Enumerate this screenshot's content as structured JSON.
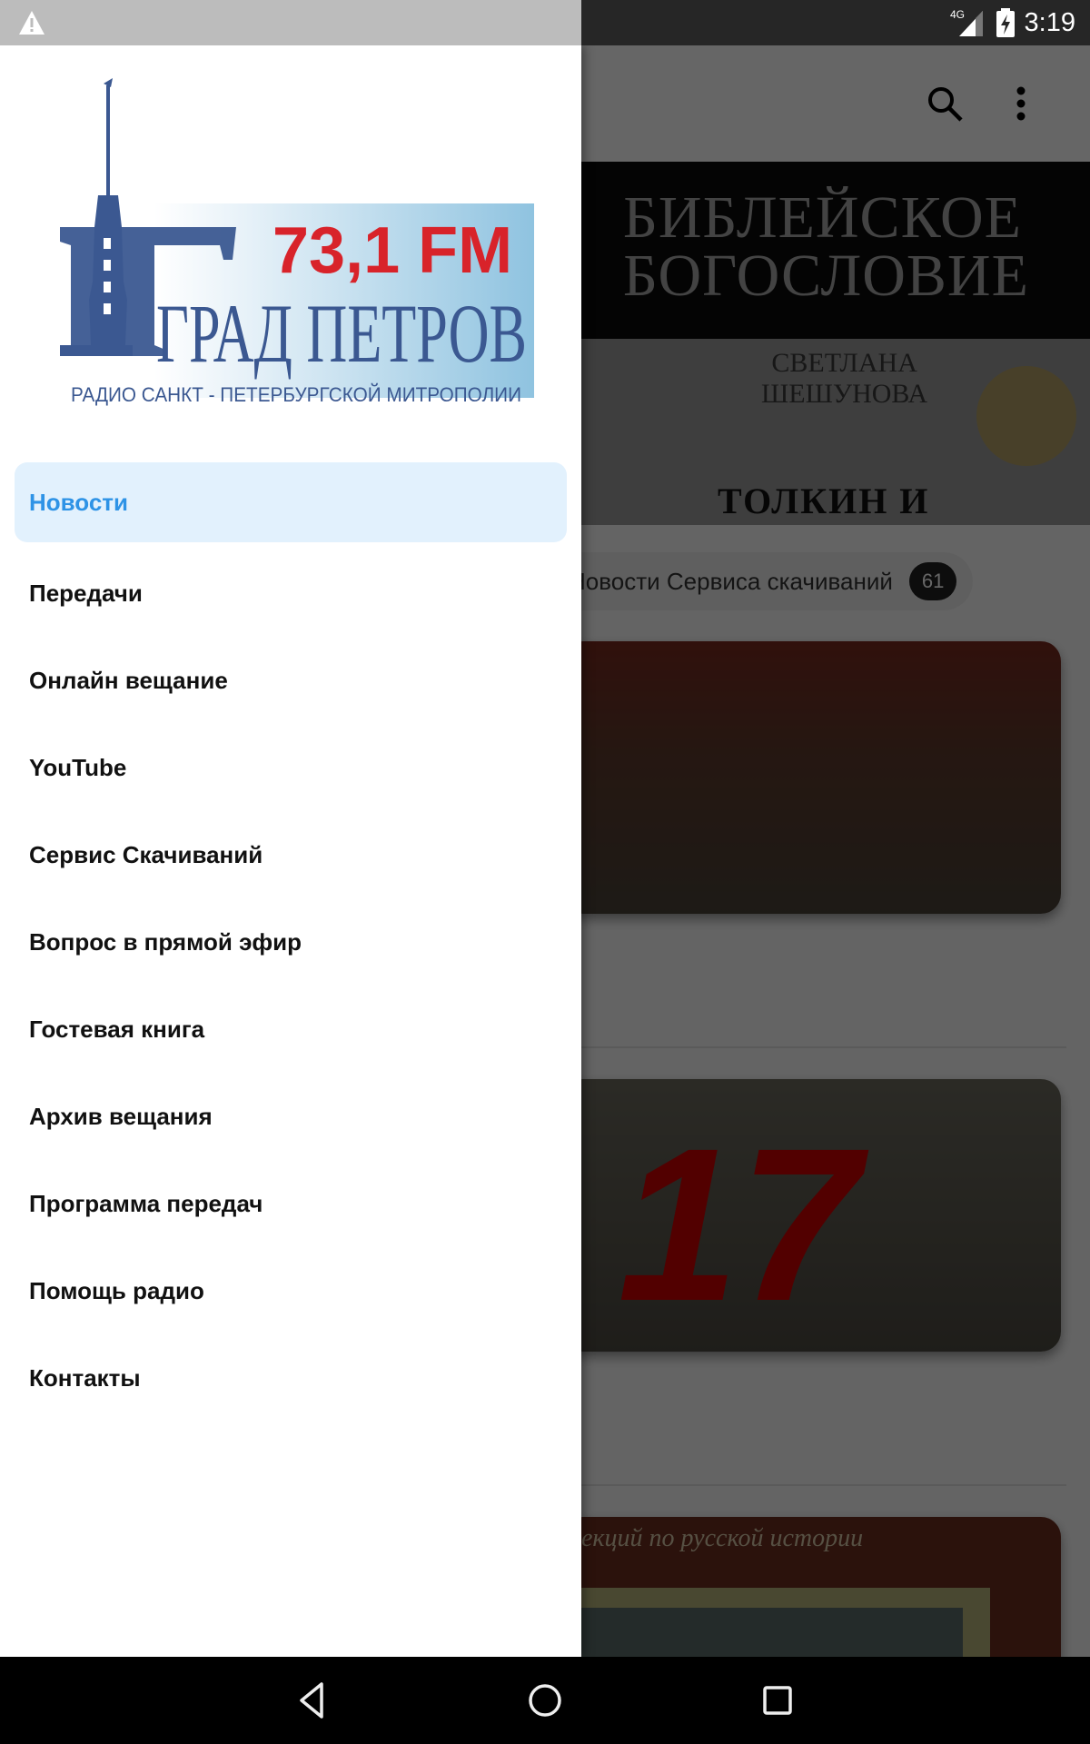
{
  "status_bar": {
    "time": "3:19",
    "network": "4G",
    "icons": [
      "warning-icon",
      "signal-icon",
      "battery-charging-icon"
    ]
  },
  "toolbar": {
    "icons": [
      "search-icon",
      "more-vert-icon"
    ]
  },
  "banner": {
    "title_line1": "БИБЛЕЙСКОЕ",
    "title_line2": "БОГОСЛОВИЕ",
    "author_line1": "СВЕТЛАНА",
    "author_line2": "ШЕШУНОВА",
    "book": "ТОЛКИН И ЛЬЮИС"
  },
  "category_chip": {
    "label": "Новости Сервиса скачиваний",
    "count": "61"
  },
  "cards": [
    {
      "image": "crowd-with-portrait-photo"
    },
    {
      "image": "number-17-banner-photo",
      "overlay_text": "17"
    },
    {
      "image": "history-lectures-photo",
      "caption": "екций по русской истории"
    }
  ],
  "drawer": {
    "logo": {
      "frequency": "73,1 FM",
      "name": "ГРАД ПЕТРОВ",
      "tagline": "РАДИО САНКТ - ПЕТЕРБУРГСКОЙ МИТРОПОЛИИ",
      "colors": {
        "blue": "#3b5891",
        "red": "#d8232a",
        "light_blue": "#a8d0e6"
      }
    },
    "active_color": "#2e93e6",
    "active_bg": "#e2f1fd",
    "items": [
      {
        "label": "Новости",
        "active": true
      },
      {
        "label": "Передачи"
      },
      {
        "label": "Онлайн вещание"
      },
      {
        "label": "YouTube"
      },
      {
        "label": "Сервис Скачиваний"
      },
      {
        "label": "Вопрос в прямой эфир"
      },
      {
        "label": "Гостевая книга"
      },
      {
        "label": "Архив вещания"
      },
      {
        "label": "Программа передач"
      },
      {
        "label": "Помощь радио"
      },
      {
        "label": "Контакты"
      }
    ]
  },
  "nav_bar": {
    "buttons": [
      "back-icon",
      "home-icon",
      "recents-icon"
    ]
  }
}
